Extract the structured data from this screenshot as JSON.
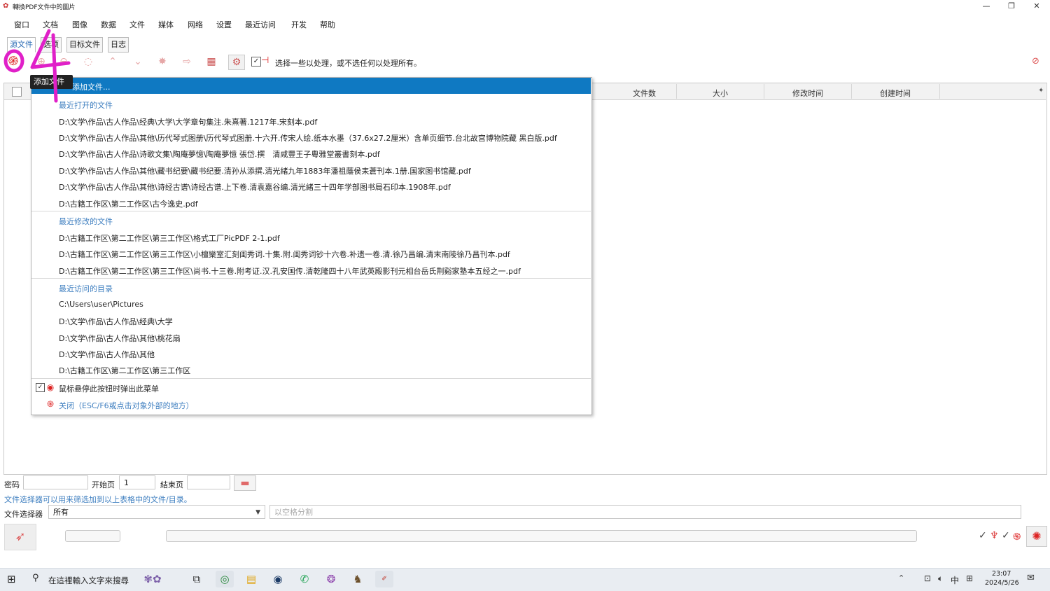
{
  "window": {
    "title": "轉換PDF文件中的圖片"
  },
  "menubar": [
    "窗口",
    "文档",
    "图像",
    "数据",
    "文件",
    "媒体",
    "网络",
    "设置",
    "最近访问",
    "开发",
    "帮助"
  ],
  "tabs": [
    "源文件",
    "选项",
    "目标文件",
    "日志"
  ],
  "toolbar": {
    "hint": "选择一些以处理，或不选任何以处理所有。"
  },
  "tooltip": "添加文件",
  "table": {
    "columns": [
      "文件数",
      "大小",
      "修改时间",
      "创建时间"
    ]
  },
  "popup": {
    "highlighted": "添加文件...",
    "sections": [
      {
        "title": "最近打开的文件",
        "items": [
          "D:\\文学\\作品\\古人作品\\经典\\大学\\大学章句集注.朱熹著.1217年.宋刻本.pdf",
          "D:\\文学\\作品\\古人作品\\其他\\历代琴式图册\\历代琴式图册.十六开.传宋人绘.纸本水墨（37.6x27.2厘米）含单页细节.台北故宫博物院藏 黑白版.pdf",
          "D:\\文学\\作品\\古人作品\\诗歌文集\\陶庵夢憶\\陶庵夢憶 張岱.撰　清咸豐王子粵雅堂叢書刻本.pdf",
          "D:\\文学\\作品\\古人作品\\其他\\藏书纪要\\藏书纪要.清孙从添撰.清光緒九年1883年潘祖蔭侯耒蒼刊本.1册.国家图书馆藏.pdf",
          "D:\\文学\\作品\\古人作品\\其他\\诗经古谱\\诗经古谱.上下卷.清袁嘉谷编.清光緒三十四年学部图书局石印本.1908年.pdf",
          "D:\\古籍工作区\\第二工作区\\古今逸史.pdf"
        ]
      },
      {
        "title": "最近修改的文件",
        "items": [
          "D:\\古籍工作区\\第二工作区\\第三工作区\\格式工厂PicPDF 2-1.pdf",
          "D:\\古籍工作区\\第二工作区\\第三工作区\\小檀欒室汇刻闺秀词.十集.附.闺秀词钞十六卷.补遗一卷.清.徐乃昌编.清末南陵徐乃昌刊本.pdf",
          "D:\\古籍工作区\\第二工作区\\第三工作区\\尚书.十三卷.附考证.汉.孔安国传.清乾隆四十八年武英殿影刊元相台岳氏荆谿家塾本五经之一.pdf"
        ]
      },
      {
        "title": "最近访问的目录",
        "items": [
          "C:\\Users\\user\\Pictures",
          "D:\\文学\\作品\\古人作品\\经典\\大学",
          "D:\\文学\\作品\\古人作品\\其他\\桃花扇",
          "D:\\文学\\作品\\古人作品\\其他",
          "D:\\古籍工作区\\第二工作区\\第三工作区"
        ]
      }
    ],
    "hover_option": "鼠标悬停此按钮时弹出此菜单",
    "close_option": "关闭（ESC/F6或点击对象外部的地方）"
  },
  "form": {
    "password_label": "密码",
    "start_page_label": "开始页",
    "start_page_value": "1",
    "end_page_label": "結束页",
    "hint": "文件选择器可以用来筛选加到以上表格中的文件/目录。",
    "selector_label": "文件选择器",
    "selector_value": "所有",
    "selector_placeholder": "以空格分割"
  },
  "taskbar": {
    "search_placeholder": "在這裡輸入文字來搜尋",
    "ime_label": "中",
    "time": "23:07",
    "date": "2024/5/26"
  },
  "handwriting": "04",
  "colors": {
    "accent": "#0f79c2",
    "section": "#3f7fc0",
    "handwriting": "#e020c8"
  }
}
